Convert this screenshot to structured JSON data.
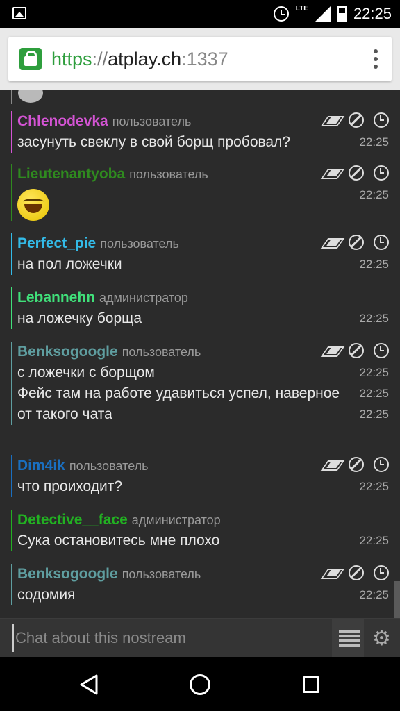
{
  "statusbar": {
    "time": "22:25",
    "network": "LTE"
  },
  "browser": {
    "url_scheme": "https",
    "url_sep": "://",
    "url_host": "atplay.ch",
    "url_port": ":1337"
  },
  "messages": [
    {
      "nick": "Chlenodevka",
      "role": "пользователь",
      "color": "#d454d4",
      "mod_actions": true,
      "lines": [
        {
          "text": "засунуть свеклу в свой борщ пробовал?",
          "time": "22:25"
        }
      ]
    },
    {
      "nick": "Lieutenantyoba",
      "role": "пользователь",
      "color": "#2f8a1f",
      "mod_actions": true,
      "lines": [
        {
          "emoji": "laughing-face",
          "time": "22:25"
        }
      ]
    },
    {
      "nick": "Perfect_pie",
      "role": "пользователь",
      "color": "#33bbe8",
      "mod_actions": true,
      "lines": [
        {
          "text": "на пол ложечки",
          "time": "22:25"
        }
      ]
    },
    {
      "nick": "Lebannehn",
      "role": "администратор",
      "color": "#40e07a",
      "mod_actions": false,
      "lines": [
        {
          "text": "на ложечку борща",
          "time": "22:25"
        }
      ]
    },
    {
      "nick": "Benksogoogle",
      "role": "пользователь",
      "color": "#5f9ea0",
      "mod_actions": true,
      "lines": [
        {
          "text": "с ложечки с борщом",
          "time": "22:25"
        },
        {
          "text": "Фейс там на работе удавиться успел, наверное",
          "time": "22:25"
        },
        {
          "text": "от такого чата",
          "time": "22:25"
        }
      ]
    },
    {
      "nick": "Dim4ik",
      "role": "пользователь",
      "color": "#1a6fc0",
      "mod_actions": true,
      "lines": [
        {
          "text": "что проиходит?",
          "time": "22:25"
        }
      ]
    },
    {
      "nick": "Detective__face",
      "role": "администратор",
      "color": "#22b022",
      "mod_actions": false,
      "lines": [
        {
          "text": "Сука остановитесь мне плохо",
          "time": "22:25"
        }
      ]
    },
    {
      "nick": "Benksogoogle",
      "role": "пользователь",
      "color": "#5f9ea0",
      "mod_actions": true,
      "lines": [
        {
          "text": "содомия",
          "time": "22:25"
        }
      ]
    }
  ],
  "input": {
    "placeholder": "Chat about this nostream"
  },
  "icons": {
    "delete": "eraser-icon",
    "ban": "ban-icon",
    "timeout": "clock-icon",
    "userlist": "list-icon",
    "settings": "gear-icon"
  }
}
